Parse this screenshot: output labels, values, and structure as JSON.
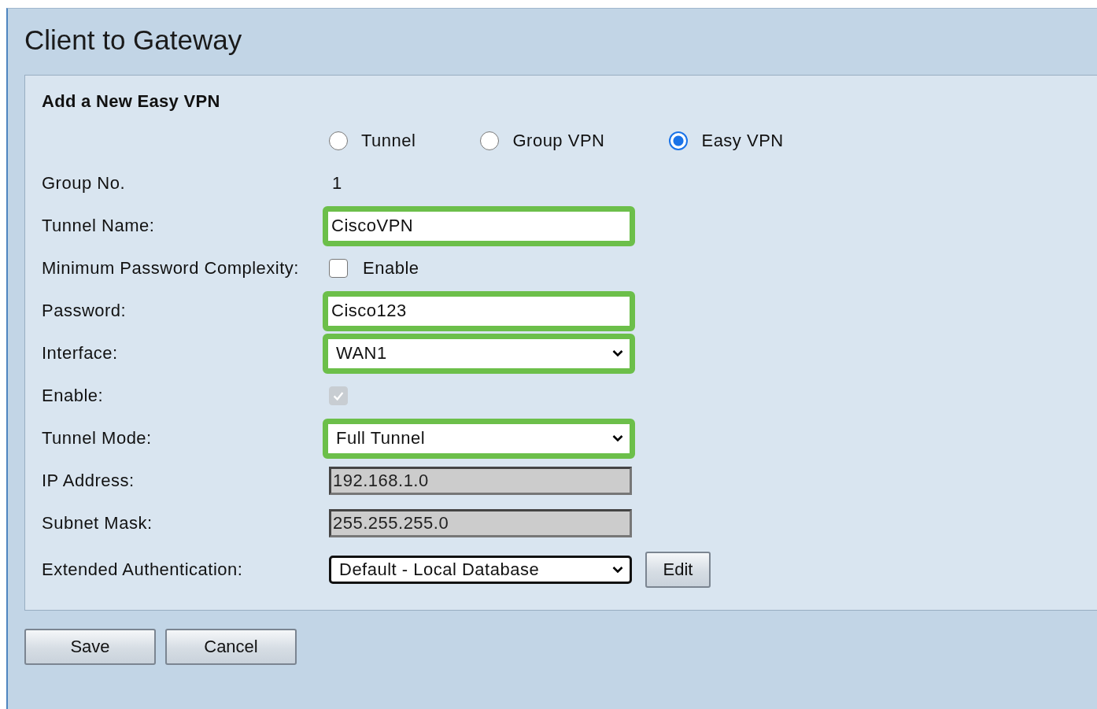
{
  "page": {
    "title": "Client to Gateway"
  },
  "form": {
    "heading": "Add a New Easy VPN",
    "rows": [
      {
        "kind": "radio",
        "options": [
          {
            "label": "Tunnel",
            "selected": false
          },
          {
            "label": "Group VPN",
            "selected": false
          },
          {
            "label": "Easy VPN",
            "selected": true
          }
        ]
      },
      {
        "kind": "text",
        "label": "Group No.",
        "value": "1"
      },
      {
        "kind": "input",
        "label": "Tunnel Name:",
        "value": "CiscoVPN",
        "highlighted": true,
        "disabled": false
      },
      {
        "kind": "checkbox",
        "label": "Minimum Password Complexity:",
        "option": "Enable",
        "checked": false,
        "disabled": false
      },
      {
        "kind": "input",
        "label": "Password:",
        "value": "Cisco123",
        "highlighted": true,
        "disabled": false
      },
      {
        "kind": "select",
        "label": "Interface:",
        "value": "WAN1",
        "highlighted": true
      },
      {
        "kind": "checkbox",
        "label": "Enable:",
        "checked": true,
        "disabled": true
      },
      {
        "kind": "select",
        "label": "Tunnel Mode:",
        "value": "Full Tunnel",
        "highlighted": true
      },
      {
        "kind": "input",
        "label": "IP Address:",
        "value": "192.168.1.0",
        "highlighted": false,
        "disabled": true
      },
      {
        "kind": "input",
        "label": "Subnet Mask:",
        "value": "255.255.255.0",
        "highlighted": false,
        "disabled": true
      },
      {
        "kind": "select",
        "label": "Extended Authentication:",
        "value": "Default - Local Database",
        "highlighted": false,
        "button": "Edit"
      }
    ]
  },
  "buttons": [
    "Save",
    "Cancel"
  ]
}
